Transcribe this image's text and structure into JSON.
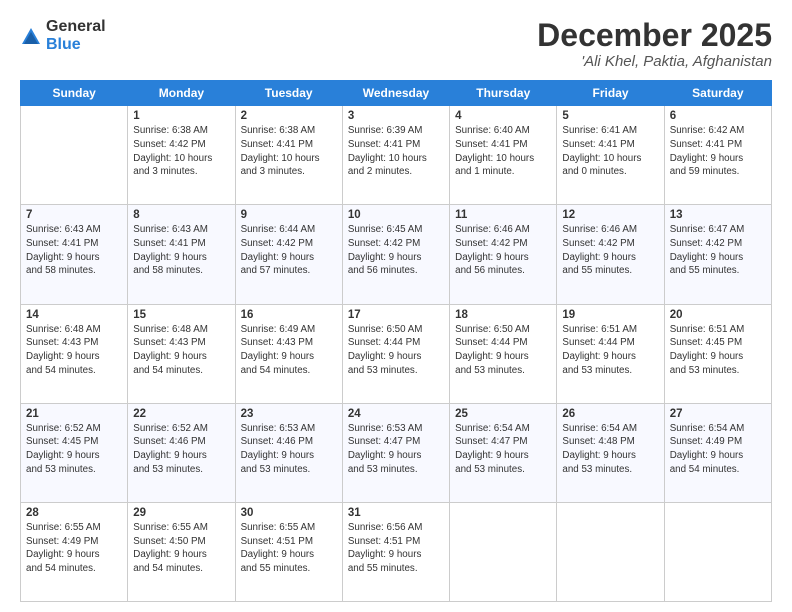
{
  "logo": {
    "general": "General",
    "blue": "Blue"
  },
  "header": {
    "title": "December 2025",
    "subtitle": "'Ali Khel, Paktia, Afghanistan"
  },
  "weekdays": [
    "Sunday",
    "Monday",
    "Tuesday",
    "Wednesday",
    "Thursday",
    "Friday",
    "Saturday"
  ],
  "weeks": [
    [
      {
        "day": "",
        "info": ""
      },
      {
        "day": "1",
        "info": "Sunrise: 6:38 AM\nSunset: 4:42 PM\nDaylight: 10 hours\nand 3 minutes."
      },
      {
        "day": "2",
        "info": "Sunrise: 6:38 AM\nSunset: 4:41 PM\nDaylight: 10 hours\nand 3 minutes."
      },
      {
        "day": "3",
        "info": "Sunrise: 6:39 AM\nSunset: 4:41 PM\nDaylight: 10 hours\nand 2 minutes."
      },
      {
        "day": "4",
        "info": "Sunrise: 6:40 AM\nSunset: 4:41 PM\nDaylight: 10 hours\nand 1 minute."
      },
      {
        "day": "5",
        "info": "Sunrise: 6:41 AM\nSunset: 4:41 PM\nDaylight: 10 hours\nand 0 minutes."
      },
      {
        "day": "6",
        "info": "Sunrise: 6:42 AM\nSunset: 4:41 PM\nDaylight: 9 hours\nand 59 minutes."
      }
    ],
    [
      {
        "day": "7",
        "info": "Sunrise: 6:43 AM\nSunset: 4:41 PM\nDaylight: 9 hours\nand 58 minutes."
      },
      {
        "day": "8",
        "info": "Sunrise: 6:43 AM\nSunset: 4:41 PM\nDaylight: 9 hours\nand 58 minutes."
      },
      {
        "day": "9",
        "info": "Sunrise: 6:44 AM\nSunset: 4:42 PM\nDaylight: 9 hours\nand 57 minutes."
      },
      {
        "day": "10",
        "info": "Sunrise: 6:45 AM\nSunset: 4:42 PM\nDaylight: 9 hours\nand 56 minutes."
      },
      {
        "day": "11",
        "info": "Sunrise: 6:46 AM\nSunset: 4:42 PM\nDaylight: 9 hours\nand 56 minutes."
      },
      {
        "day": "12",
        "info": "Sunrise: 6:46 AM\nSunset: 4:42 PM\nDaylight: 9 hours\nand 55 minutes."
      },
      {
        "day": "13",
        "info": "Sunrise: 6:47 AM\nSunset: 4:42 PM\nDaylight: 9 hours\nand 55 minutes."
      }
    ],
    [
      {
        "day": "14",
        "info": "Sunrise: 6:48 AM\nSunset: 4:43 PM\nDaylight: 9 hours\nand 54 minutes."
      },
      {
        "day": "15",
        "info": "Sunrise: 6:48 AM\nSunset: 4:43 PM\nDaylight: 9 hours\nand 54 minutes."
      },
      {
        "day": "16",
        "info": "Sunrise: 6:49 AM\nSunset: 4:43 PM\nDaylight: 9 hours\nand 54 minutes."
      },
      {
        "day": "17",
        "info": "Sunrise: 6:50 AM\nSunset: 4:44 PM\nDaylight: 9 hours\nand 53 minutes."
      },
      {
        "day": "18",
        "info": "Sunrise: 6:50 AM\nSunset: 4:44 PM\nDaylight: 9 hours\nand 53 minutes."
      },
      {
        "day": "19",
        "info": "Sunrise: 6:51 AM\nSunset: 4:44 PM\nDaylight: 9 hours\nand 53 minutes."
      },
      {
        "day": "20",
        "info": "Sunrise: 6:51 AM\nSunset: 4:45 PM\nDaylight: 9 hours\nand 53 minutes."
      }
    ],
    [
      {
        "day": "21",
        "info": "Sunrise: 6:52 AM\nSunset: 4:45 PM\nDaylight: 9 hours\nand 53 minutes."
      },
      {
        "day": "22",
        "info": "Sunrise: 6:52 AM\nSunset: 4:46 PM\nDaylight: 9 hours\nand 53 minutes."
      },
      {
        "day": "23",
        "info": "Sunrise: 6:53 AM\nSunset: 4:46 PM\nDaylight: 9 hours\nand 53 minutes."
      },
      {
        "day": "24",
        "info": "Sunrise: 6:53 AM\nSunset: 4:47 PM\nDaylight: 9 hours\nand 53 minutes."
      },
      {
        "day": "25",
        "info": "Sunrise: 6:54 AM\nSunset: 4:47 PM\nDaylight: 9 hours\nand 53 minutes."
      },
      {
        "day": "26",
        "info": "Sunrise: 6:54 AM\nSunset: 4:48 PM\nDaylight: 9 hours\nand 53 minutes."
      },
      {
        "day": "27",
        "info": "Sunrise: 6:54 AM\nSunset: 4:49 PM\nDaylight: 9 hours\nand 54 minutes."
      }
    ],
    [
      {
        "day": "28",
        "info": "Sunrise: 6:55 AM\nSunset: 4:49 PM\nDaylight: 9 hours\nand 54 minutes."
      },
      {
        "day": "29",
        "info": "Sunrise: 6:55 AM\nSunset: 4:50 PM\nDaylight: 9 hours\nand 54 minutes."
      },
      {
        "day": "30",
        "info": "Sunrise: 6:55 AM\nSunset: 4:51 PM\nDaylight: 9 hours\nand 55 minutes."
      },
      {
        "day": "31",
        "info": "Sunrise: 6:56 AM\nSunset: 4:51 PM\nDaylight: 9 hours\nand 55 minutes."
      },
      {
        "day": "",
        "info": ""
      },
      {
        "day": "",
        "info": ""
      },
      {
        "day": "",
        "info": ""
      }
    ]
  ]
}
